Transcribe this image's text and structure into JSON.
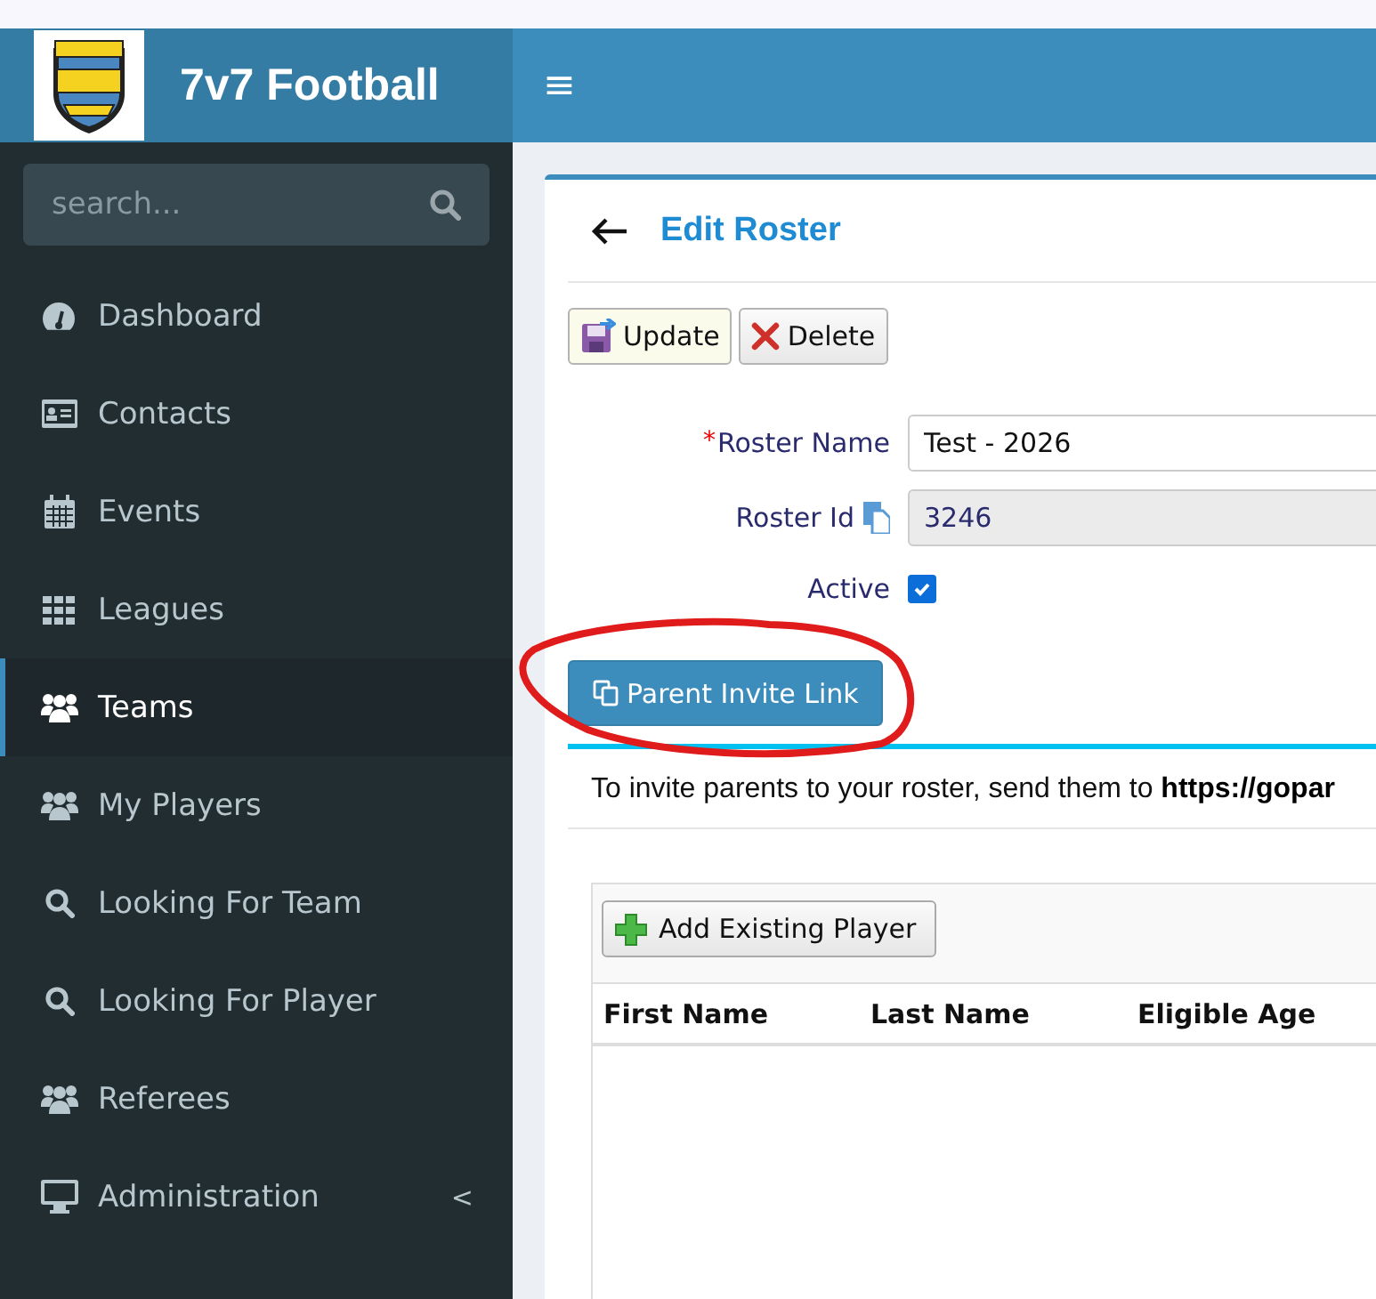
{
  "header": {
    "brand": "7v7 Football",
    "menu_toggle": "≡"
  },
  "sidebar": {
    "search": {
      "placeholder": "search..."
    },
    "items": [
      {
        "label": "Dashboard",
        "kind": "gauge",
        "selected": false
      },
      {
        "label": "Contacts",
        "kind": "card",
        "selected": false
      },
      {
        "label": "Events",
        "kind": "calendar",
        "selected": false
      },
      {
        "label": "Leagues",
        "kind": "grid",
        "selected": false
      },
      {
        "label": "Teams",
        "kind": "users",
        "selected": true
      },
      {
        "label": "My Players",
        "kind": "users",
        "selected": false
      },
      {
        "label": "Looking For Team",
        "kind": "search",
        "selected": false
      },
      {
        "label": "Looking For Player",
        "kind": "search",
        "selected": false
      },
      {
        "label": "Referees",
        "kind": "users",
        "selected": false
      },
      {
        "label": "Administration",
        "kind": "monitor",
        "selected": false,
        "caret": "<"
      }
    ]
  },
  "title": "Edit Roster",
  "toolbar": [
    {
      "label": "Update",
      "kind": "update"
    },
    {
      "label": "Delete",
      "kind": "delete"
    }
  ],
  "form": [
    {
      "label": "Roster Name",
      "kind": "text",
      "required_mark": "*",
      "value": "Test - 2026"
    },
    {
      "label": "Roster Id",
      "kind": "readonly",
      "value": "3246"
    },
    {
      "label": "Active",
      "kind": "checkbox",
      "checked": true
    }
  ],
  "invite_button": "Parent Invite Link",
  "callout": "To invite parents to your roster, send them to **https://gopar**",
  "players": {
    "add_button": "Add Existing Player",
    "columns": [
      "First Name",
      "Last Name",
      "Eligible Age"
    ]
  }
}
